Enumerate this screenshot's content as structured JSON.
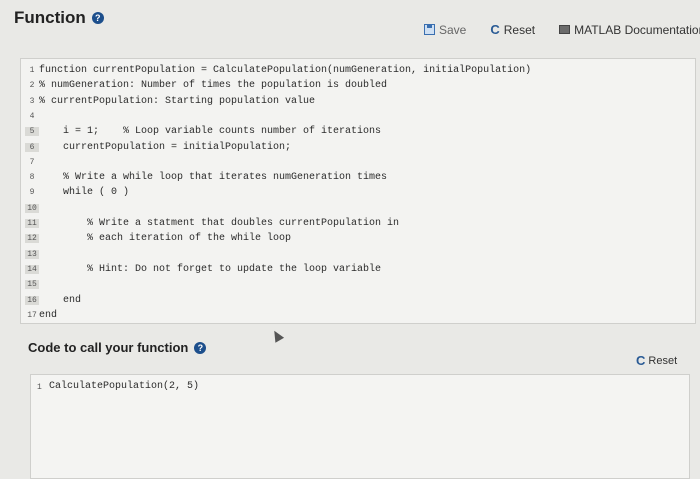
{
  "header": {
    "title": "Function"
  },
  "toolbar": {
    "save_label": "Save",
    "reset_label": "Reset",
    "doc_label": "MATLAB Documentation"
  },
  "editor": {
    "line_numbers": [
      "1",
      "2",
      "3",
      "4",
      "5",
      "6",
      "7",
      "8",
      "9",
      "10",
      "11",
      "12",
      "13",
      "14",
      "15",
      "16",
      "17"
    ],
    "lines": [
      "function currentPopulation = CalculatePopulation(numGeneration, initialPopulation)",
      "% numGeneration: Number of times the population is doubled",
      "% currentPopulation: Starting population value",
      "",
      "    i = 1;    % Loop variable counts number of iterations",
      "    currentPopulation = initialPopulation;",
      "",
      "    % Write a while loop that iterates numGeneration times",
      "    while ( 0 )",
      "",
      "        % Write a statment that doubles currentPopulation in",
      "        % each iteration of the while loop",
      "",
      "        % Hint: Do not forget to update the loop variable",
      "",
      "    end",
      "end"
    ]
  },
  "call": {
    "title": "Code to call your function",
    "reset_label": "Reset",
    "line_number": "1",
    "code": "CalculatePopulation(2, 5)"
  }
}
